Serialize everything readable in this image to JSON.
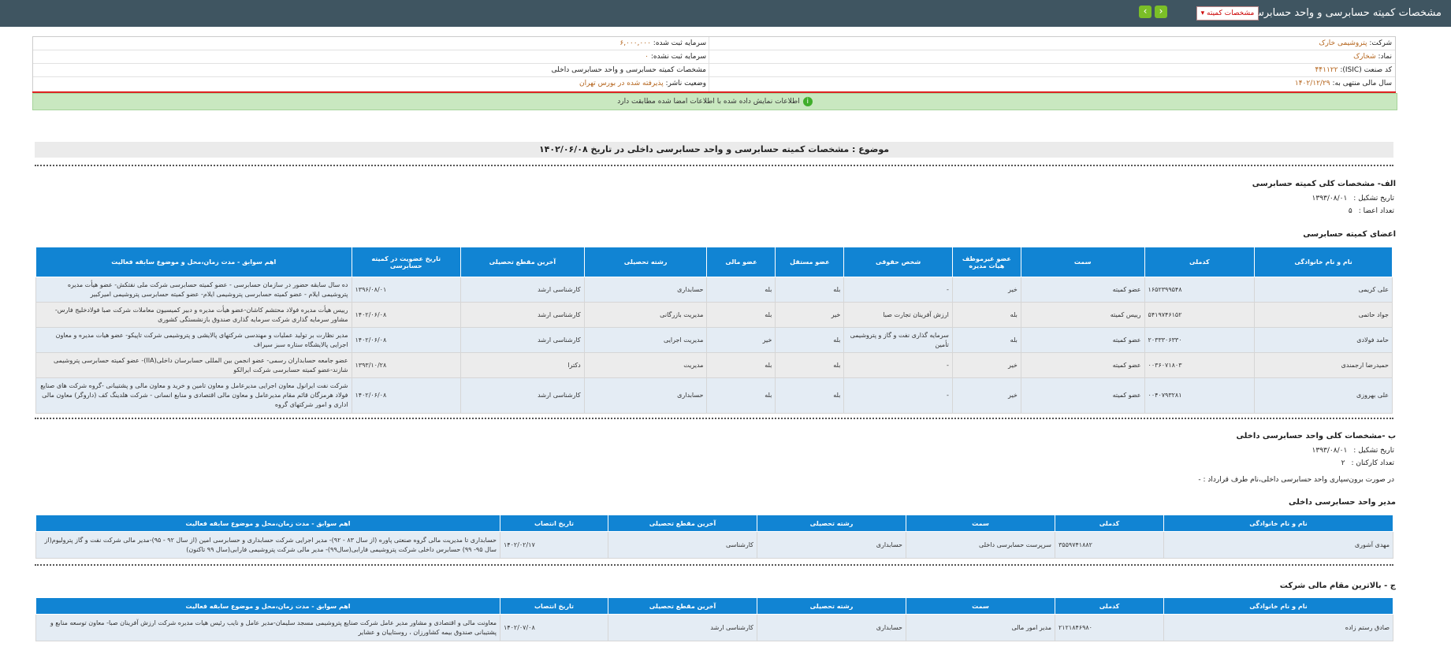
{
  "header": {
    "title": "مشخصات کمیته حسابرسی و واحد حسابرسی داخلی",
    "select_value": "مشخصات کمیته",
    "nav_prev": "›",
    "nav_next": "‹"
  },
  "company_info": {
    "company_label": "شرکت:",
    "company_value": "پتروشیمی خارک",
    "symbol_label": "نماد:",
    "symbol_value": "شخارک",
    "isic_label": "کد صنعت (ISIC):",
    "isic_value": "۴۴۱۱۲۲",
    "fiscal_label": "سال مالی منتهی به:",
    "fiscal_value": "۱۴۰۲/۱۲/۲۹",
    "registered_capital_label": "سرمایه ثبت شده:",
    "registered_capital_value": "۶,۰۰۰,۰۰۰",
    "unregistered_capital_label": "سرمایه ثبت نشده:",
    "unregistered_capital_value": "۰",
    "report_title": "مشخصات کمیته حسابرسی و واحد حسابرسی داخلی",
    "publisher_status_label": "وضعیت ناشر:",
    "publisher_status_value": "پذیرفته شده در بورس تهران"
  },
  "notice": {
    "text": "اطلاعات نمایش داده شده با اطلاعات امضا شده مطابقت دارد",
    "icon": "info-icon"
  },
  "subject": "موضوع : مشخصات کمیته حسابرسی و واحد حسابرسی داخلی در تاریخ ۱۴۰۲/۰۶/۰۸",
  "section_a": {
    "title": "الف- مشخصات کلی کمیته حسابرسی",
    "formation_label": "تاریخ تشکیل :",
    "formation_value": "۱۳۹۳/۰۸/۰۱",
    "members_count_label": "تعداد اعضا :",
    "members_count_value": "۵",
    "members_title": "اعضای کمیته حسابرسی",
    "columns": [
      "نام و نام خانوادگی",
      "کدملی",
      "سمت",
      "عضو غیرموظف هیات مدیره",
      "شخص حقوقی",
      "عضو مستقل",
      "عضو مالی",
      "رشته تحصیلی",
      "آخرین مقطع تحصیلی",
      "تاریخ عضویت در کمیته حسابرسی",
      "اهم سوابق - مدت زمان،محل و موضوع سابقه فعالیت"
    ],
    "rows": [
      [
        "علی کریمی",
        "۱۶۵۲۳۹۹۵۴۸",
        "عضو کمیته",
        "خیر",
        "-",
        "بله",
        "بله",
        "حسابداری",
        "کارشناسی ارشد",
        "۱۳۹۶/۰۸/۰۱",
        "ده سال سابقه حضور در سازمان حسابرسی - عضو کمیته حسابرسی شرکت ملی نفتکش- عضو هیأت مدیره پتروشیمی ایلام - عضو کمیته حسابرسی پتروشیمی ایلام- عضو کمیته حسابرسی پتروشیمی امیرکبیر"
      ],
      [
        "جواد حاتمی",
        "۵۴۱۹۷۴۶۱۵۲",
        "رییس کمیته",
        "بله",
        "ارزش آفرینان تجارت صبا",
        "خیر",
        "بله",
        "مدیریت بازرگانی",
        "کارشناسی ارشد",
        "۱۴۰۲/۰۶/۰۸",
        "رییس هیأت مدیره فولاد محتشم کاشان-عضو هیأت مدیره و دبیر کمیسیون معاملات شرکت صبا فولادخلیج فارس- مشاور سرمایه گذاری شرکت سرمایه گذاری صندوق بازنشستگی کشوری"
      ],
      [
        "حامد فولادی",
        "۲۰۳۳۳۰۶۳۳۰",
        "عضو کمیته",
        "بله",
        "سرمایه گذاری نفت و گاز و پتروشیمی تأمین",
        "بله",
        "خیر",
        "مدیریت اجرایی",
        "کارشناسی ارشد",
        "۱۴۰۲/۰۶/۰۸",
        "مدیر نظارت بر تولید عملیات و مهندسی شرکتهای پالایشی و پتروشیمی شرکت تاپیکو- عضو هیات مدیره و معاون اجرایی پالایشگاه ستاره سبز سیراف"
      ],
      [
        "حمیدرضا ارجمندی",
        "۰۰۳۶۰۷۱۸۰۳",
        "عضو کمیته",
        "خیر",
        "-",
        "بله",
        "بله",
        "مدیریت",
        "دکترا",
        "۱۳۹۳/۱۰/۲۸",
        "عضو جامعه حسابداران رسمی- عضو انجمن بین المللی حسابرسان داخلی(IIA)- عضو کمیته حسابرسی پتروشیمی شازند-عضو کمیته حسابرسی شرکت ایرالکو"
      ],
      [
        "علی بهروزی",
        "۰۰۴۰۷۹۳۲۸۱",
        "عضو کمیته",
        "خیر",
        "-",
        "بله",
        "بله",
        "حسابداری",
        "کارشناسی ارشد",
        "۱۴۰۲/۰۶/۰۸",
        "شرکت نفت ایرانول معاون اجرایی مدیرعامل و معاون تامین و خرید و معاون مالی و پشتیبانی -گروه شرکت های صنایع فولاد هرمزگان قائم مقام مدیرعامل و معاون مالی اقتصادی و منابع انسانی - شرکت هلدینگ کف (داروگر) معاون مالی اداری و امور شرکتهای گروه"
      ]
    ]
  },
  "section_b": {
    "title": "ب -مشخصات کلی واحد حسابرسی داخلی",
    "formation_label": "تاریخ تشکیل :",
    "formation_value": "۱۳۹۳/۰۸/۰۱",
    "staff_label": "تعداد کارکنان :",
    "staff_value": "۲",
    "outsourcing_text": "در صورت برون‌سپاری واحد حسابرسی داخلی،نام طرف قرارداد : -",
    "manager_title": "مدیر واحد حسابرسی داخلی",
    "columns": [
      "نام و نام خانوادگی",
      "کدملی",
      "سمت",
      "رشته تحصیلی",
      "آخرین مقطع تحصیلی",
      "تاریخ انتصاب",
      "اهم سوابق - مدت زمان،محل و موضوع سابقه فعالیت"
    ],
    "rows": [
      [
        "مهدی آشوری",
        "۳۵۵۹۷۴۱۸۸۲",
        "سرپرست حسابرسی داخلی",
        "حسابداری",
        "کارشناسی",
        "۱۴۰۲/۰۲/۱۷",
        "حسابداری تا مدیریت مالی گروه صنعتی پاوره (از سال ۸۳ - ۹۲)- مدیر اجرایی شرکت حسابداری و حسابرسی امین (از سال ۹۲ - ۹۵)-مدیر مالی شرکت نفت و گاز پترولیوم(از سال ۹۵- ۹۹) حسابرس داخلی شرکت پتروشیمی فارابی(سال۹۹)- مدیر مالی شرکت پتروشیمی فارابی(سال ۹۹ تاکنون)"
      ]
    ]
  },
  "section_c": {
    "title": "ج - بالاترین مقام مالی شرکت",
    "columns": [
      "نام و نام خانوادگی",
      "کدملی",
      "سمت",
      "رشته تحصیلی",
      "آخرین مقطع تحصیلی",
      "تاریخ انتصاب",
      "اهم سوابق - مدت زمان،محل و موضوع سابقه فعالیت"
    ],
    "rows": [
      [
        "صادق رستم زاده",
        "۲۱۲۱۸۴۶۹۸۰",
        "مدیر امور مالی",
        "حسابداری",
        "کارشناسی ارشد",
        "۱۴۰۲/۰۷/۰۸",
        "معاونت مالی و اقتصادی و مشاور مدیر عامل شرکت صنایع پتروشیمی مسجد سلیمان-مدیر عامل و نایب رئیس هیات مدیره شرکت ارزش آفرینان صبا- معاون توسعه منابع و پشتیبانی صندوق بیمه کشاورزان ، روستاییان و عشایر"
      ]
    ]
  },
  "colors": {
    "topbar": "#3f5561",
    "table_header": "#1184d3",
    "notice_bg": "#c9e8c0",
    "accent_value": "#b5651d"
  }
}
